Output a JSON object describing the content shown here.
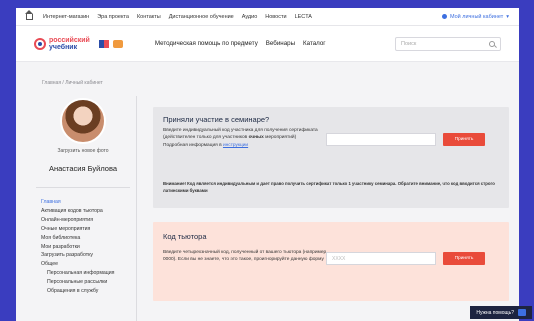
{
  "topbar": {
    "links": [
      "Интернет-магазин",
      "Эра проекта",
      "Контакты",
      "Дистанционное обучение",
      "Аудио",
      "Новости",
      "LECTA"
    ],
    "account_label": "Мой личный кабинет"
  },
  "header": {
    "logo_line1": "российский",
    "logo_line2": "учебник",
    "nav": [
      "Методическая помощь по предмету",
      "Вебинары",
      "Каталог"
    ],
    "search_placeholder": "Поиск"
  },
  "breadcrumb": "Главная / Личный кабинет",
  "sidebar": {
    "upload_photo": "Загрузить новое фото",
    "user_name": "Анастасия Буйлова",
    "menu": [
      {
        "label": "Главная",
        "active": true,
        "sub": false
      },
      {
        "label": "Активация кодов тьютора",
        "active": false,
        "sub": false
      },
      {
        "label": "Онлайн-мероприятия",
        "active": false,
        "sub": false
      },
      {
        "label": "Очные мероприятия",
        "active": false,
        "sub": false
      },
      {
        "label": "Моя библиотека",
        "active": false,
        "sub": false
      },
      {
        "label": "Мои разработки",
        "active": false,
        "sub": false
      },
      {
        "label": "Загрузить разработку",
        "active": false,
        "sub": false
      },
      {
        "label": "Общее",
        "active": false,
        "sub": false
      },
      {
        "label": "Персональная информация",
        "active": false,
        "sub": true
      },
      {
        "label": "Персональные рассылки",
        "active": false,
        "sub": true
      },
      {
        "label": "Обращения в службу",
        "active": false,
        "sub": true
      }
    ]
  },
  "seminar": {
    "title": "Приняли участие в семинаре?",
    "text1": "Введите индивидуальный код участника для получения сертификата (действителен только для участников",
    "text1_bold": "очных",
    "text1_end": "мероприятий)",
    "text2": "Подробная информация в",
    "link": "инструкции",
    "input_placeholder": "",
    "button": "Принять",
    "notice": "Внимание! Код является индивидуальным и дает право получить сертификат только 1 участнику семинара. Обратите внимание, что код вводится строго латинскими буквами"
  },
  "tutor": {
    "title": "Код тьютора",
    "text": "Введите четырехзначный код, полученный от вашего тьютора (например, 0000). Если вы не знаете, что это такое, проигнорируйте данную форму",
    "input_placeholder": "XXXX",
    "button": "Принять"
  },
  "help": "Нужна помощь?"
}
